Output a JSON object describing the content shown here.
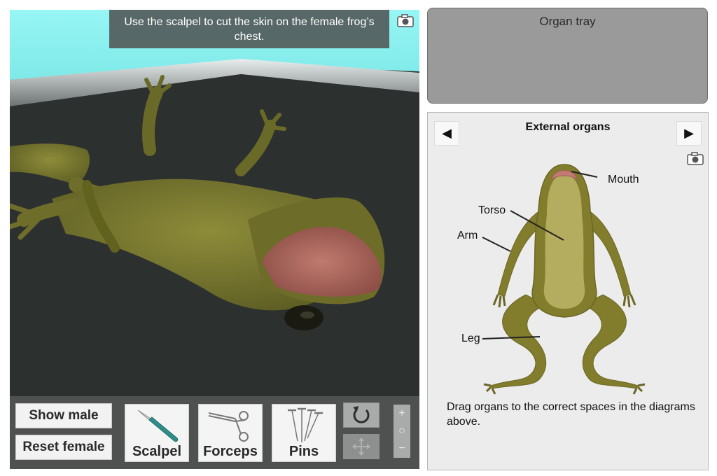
{
  "instruction": "Use the scalpel to cut the skin on the female frog’s chest.",
  "toolbar": {
    "show_male": "Show male",
    "reset_female": "Reset female",
    "tools": [
      "Scalpel",
      "Forceps",
      "Pins"
    ],
    "zoom_in": "+",
    "zoom_reset": "○",
    "zoom_out": "−"
  },
  "organ_tray": {
    "title": "Organ tray"
  },
  "diagram": {
    "prev": "◀",
    "next": "▶",
    "title": "External organs",
    "labels": {
      "mouth": "Mouth",
      "torso": "Torso",
      "arm": "Arm",
      "leg": "Leg"
    },
    "hint": "Drag organs to the correct spaces in the diagrams above."
  },
  "icons": {
    "camera": "camera-icon",
    "rotate": "rotate-icon",
    "move": "move-icon",
    "scalpel": "scalpel-icon",
    "forceps": "forceps-icon",
    "pins": "pins-icon"
  },
  "colors": {
    "frog_skin": "#7a7a2e",
    "frog_mouth": "#c87a70",
    "tray_bg": "#9a9a9a",
    "table_cyan": "#8ef3f2",
    "toolbar_bg": "#4f5150"
  }
}
